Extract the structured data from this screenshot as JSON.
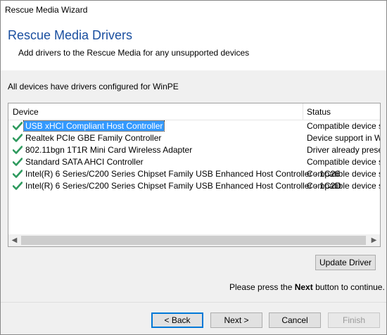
{
  "window": {
    "title": "Rescue Media Wizard"
  },
  "header": {
    "title": "Rescue Media Drivers",
    "subtitle": "Add drivers to the Rescue Media for any unsupported devices"
  },
  "status_message": "All devices have drivers configured for WinPE",
  "table": {
    "columns": [
      "Device",
      "Status"
    ],
    "rows": [
      {
        "device": "USB xHCI Compliant Host Controller",
        "status": "Compatible device su",
        "selected": true
      },
      {
        "device": "Realtek PCIe GBE Family Controller",
        "status": "Device support in W",
        "selected": false
      },
      {
        "device": "802.11bgn 1T1R Mini Card Wireless Adapter",
        "status": "Driver already prese",
        "selected": false
      },
      {
        "device": "Standard SATA AHCI Controller",
        "status": "Compatible device su",
        "selected": false
      },
      {
        "device": "Intel(R) 6 Series/C200 Series Chipset Family USB Enhanced Host Controller - 1C26",
        "status": "Compatible device su",
        "selected": false
      },
      {
        "device": "Intel(R) 6 Series/C200 Series Chipset Family USB Enhanced Host Controller - 1C2D",
        "status": "Compatible device su",
        "selected": false
      }
    ],
    "row_icon": "green-check-icon"
  },
  "buttons": {
    "update_driver": "Update Driver",
    "back": "< Back",
    "next": "Next >",
    "cancel": "Cancel",
    "finish": "Finish"
  },
  "hint": {
    "prefix": "Please press the ",
    "bold": "Next",
    "suffix": " button to continue."
  },
  "colors": {
    "header_title": "#1a4fa0",
    "selection": "#3399ff",
    "check": "#2e9a5e",
    "default_button_border": "#0078d7"
  }
}
